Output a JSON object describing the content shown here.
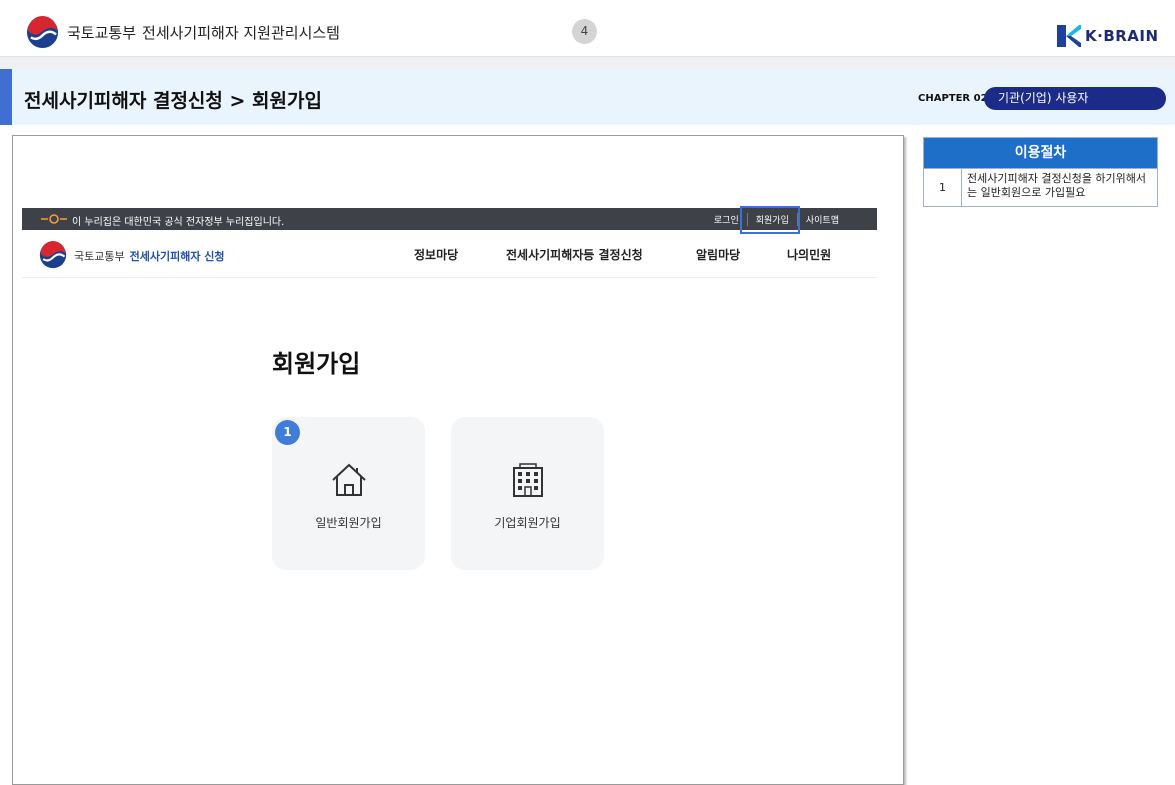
{
  "header": {
    "ministry": "국토교통부",
    "system_name": "전세사기피해자 지원관리시스템",
    "page_number": "4",
    "brand": "K·BRAIN"
  },
  "title_band": {
    "title": "전세사기피해자 결정신청 > 회원가입",
    "chapter": "CHAPTER 02",
    "role": "기관(기업) 사용자"
  },
  "screenshot": {
    "gov_banner": "이 누리집은 대한민국 공식 전자정부 누리집입니다.",
    "util_links": [
      "로그인",
      "회원가입",
      "사이트맵"
    ],
    "site_ministry": "국토교통부",
    "site_app": "전세사기피해자 신청",
    "menu": [
      "정보마당",
      "전세사기피해자등 결정신청",
      "알림마당",
      "나의민원"
    ],
    "join_title": "회원가입",
    "step_badge": "1",
    "cards": [
      "일반회원가입",
      "기업회원가입"
    ]
  },
  "procedure": {
    "heading": "이용절차",
    "rows": [
      {
        "num": "1",
        "text": "전세사기피해자 결정신청을 하기위해서는 일반회원으로 가입필요"
      }
    ]
  },
  "colors": {
    "accent": "#3f6fcf",
    "title_band": "#eaf4fd",
    "role_pill": "#1b2b87",
    "table_head": "#1e6fc8",
    "highlight": "#3a6fe0"
  }
}
